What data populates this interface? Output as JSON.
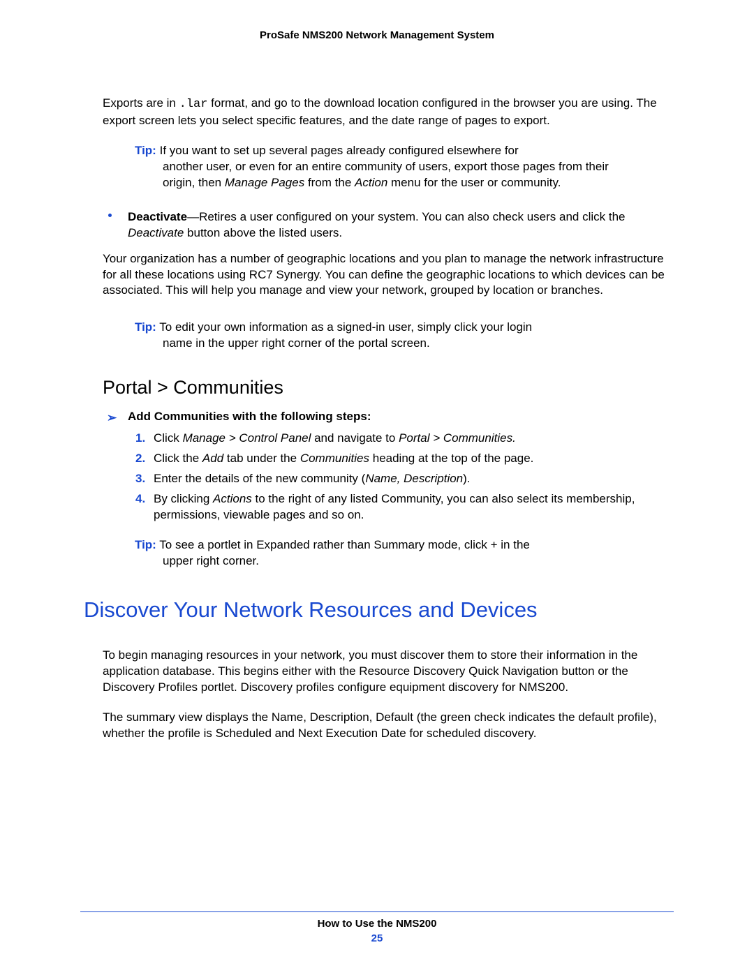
{
  "header": {
    "title": "ProSafe NMS200 Network Management System"
  },
  "intro": {
    "t1a": "Exports are in ",
    "t1code": ".lar",
    "t1b": " format, and go to the download location configured in the browser you are using. The export screen lets you select specific features, and the date range of pages to export."
  },
  "tip1": {
    "label": "Tip:",
    "first": "If you want to set up several pages already configured elsewhere for",
    "rest_a": "another user, or even for an entire community of users, export those pages from their origin, then ",
    "rest_i1": "Manage Pages",
    "rest_b": " from the ",
    "rest_i2": "Action",
    "rest_c": " menu for the user or community."
  },
  "bullet": {
    "label": "Deactivate",
    "dash": "—Retires a user configured on your system. You can also check users and click the ",
    "i1": "Deactivate",
    "tail": " button above the listed users."
  },
  "para2": "Your organization has a number of geographic locations and you plan to manage the network infrastructure for all these locations using RC7 Synergy. You can define the geographic locations to which devices can be associated. This will help you manage and view your network, grouped by location or branches.",
  "tip2": {
    "label": "Tip:",
    "first": "To edit your own information as a signed-in user, simply click your login",
    "rest": "name in the upper right corner of the portal screen."
  },
  "subheading": "Portal > Communities",
  "arrowline": "Add Communities with the following steps:",
  "steps": [
    {
      "n": "1.",
      "a": "Click ",
      "i1": "Manage > Control Panel",
      "b": " and navigate to ",
      "i2": "Portal > Communities.",
      "c": ""
    },
    {
      "n": "2.",
      "a": "Click the ",
      "i1": "Add",
      "b": " tab under the ",
      "i2": "Communities",
      "c": " heading at the top of the page."
    },
    {
      "n": "3.",
      "a": "Enter the details of the new community (",
      "i1": "Name, Description",
      "b": ").",
      "i2": "",
      "c": ""
    },
    {
      "n": "4.",
      "a": "By clicking ",
      "i1": "Actions",
      "b": " to the right of any listed Community, you can also select its membership, permissions, viewable pages and so on.",
      "i2": "",
      "c": ""
    }
  ],
  "tip3": {
    "label": "Tip:",
    "first": "To see a portlet in Expanded rather than Summary mode, click + in the",
    "rest": "upper right corner."
  },
  "mainheading": "Discover Your Network Resources and Devices",
  "para3": "To begin managing resources in your network, you must discover them to store their information in the application database. This begins either with the Resource Discovery Quick Navigation button or the Discovery Profiles portlet. Discovery profiles configure equipment discovery for NMS200.",
  "para4": "The summary view displays the Name, Description, Default (the green check indicates the default profile), whether the profile is Scheduled and Next Execution Date for scheduled discovery.",
  "footer": {
    "title": "How to Use the NMS200",
    "page": "25"
  }
}
